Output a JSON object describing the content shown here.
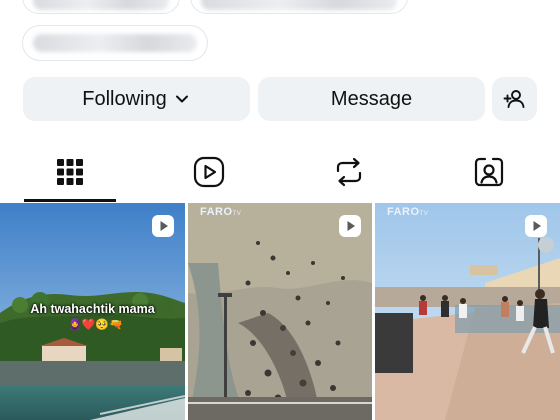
{
  "profile": {
    "buttons": {
      "following_label": "Following",
      "message_label": "Message"
    }
  },
  "tabs": [
    {
      "name": "posts-grid",
      "icon": "grid-icon",
      "active": true
    },
    {
      "name": "reels",
      "icon": "reels-icon",
      "active": false
    },
    {
      "name": "reposts",
      "icon": "repost-icon",
      "active": false
    },
    {
      "name": "tagged",
      "icon": "tagged-person-icon",
      "active": false
    }
  ],
  "posts": [
    {
      "caption": "Ah twahachtik mama",
      "emojis": "🧕❤️🥺🔫",
      "icon": "reel-icon"
    },
    {
      "watermark": "FARO",
      "watermark_suffix": "TV",
      "icon": "reel-icon"
    },
    {
      "watermark": "FARO",
      "watermark_suffix": "TV",
      "icon": "reel-icon"
    }
  ],
  "colors": {
    "button_bg": "#eff2f5",
    "text": "#111111",
    "active_indicator": "#111111"
  }
}
